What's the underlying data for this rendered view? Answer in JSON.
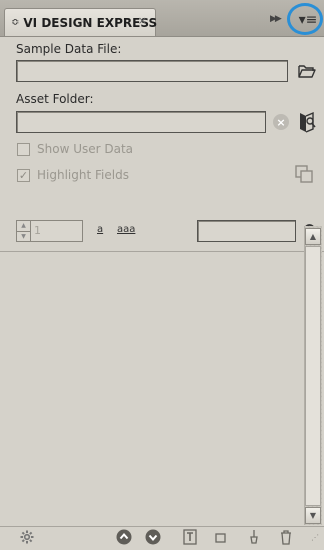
{
  "panel": {
    "tab_glyph": "≎",
    "title": "VI DESIGN EXPRESS",
    "tab_close": "×",
    "collapse_icon": "▶▶",
    "menu_icon": "▾≡"
  },
  "sample_data": {
    "label": "Sample Data File:",
    "value": "",
    "browse_icon": "folder-open-icon"
  },
  "asset_folder": {
    "label": "Asset Folder:",
    "value": "",
    "clear_icon": "clear-icon",
    "browse_icon": "folder-search-icon"
  },
  "options": {
    "show_user_data": {
      "label": "Show User Data",
      "checked": false
    },
    "highlight_fields": {
      "label": "Highlight Fields",
      "checked": true
    }
  },
  "toolbar": {
    "record_number": "1",
    "case_lower": "a",
    "case_mixed": "aaa",
    "search_value": ""
  },
  "footer": {
    "icons": [
      "gear-icon",
      "move-up-icon",
      "move-down-icon",
      "text-frame-icon",
      "frame-icon",
      "pen-icon",
      "delete-icon"
    ]
  },
  "colors": {
    "panel_bg": "#d5d2ca",
    "highlight_ring": "#2a8fd6"
  }
}
